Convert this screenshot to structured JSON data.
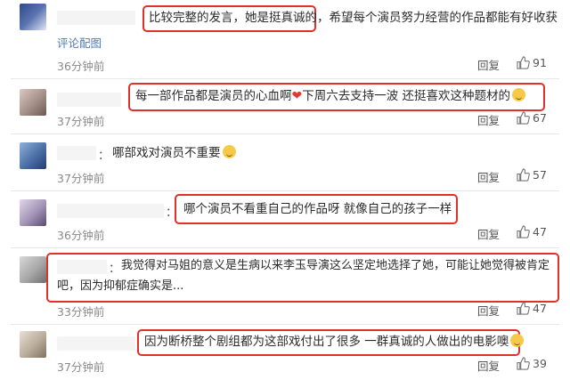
{
  "comments": [
    {
      "text": "比较完整的发言，她是挺真诚的，希望每个演员努力经营的作品都能有好收获",
      "sub_link": "评论配图",
      "time": "36分钟前",
      "reply": "回复",
      "likes": "91"
    },
    {
      "text_a": "每一部作品都是演员的心血啊",
      "heart": "❤",
      "text_b": "下周六去支持一波 还挺喜欢这种题材的",
      "time": "37分钟前",
      "reply": "回复",
      "likes": "67"
    },
    {
      "colon": "：",
      "text": "哪部戏对演员不重要",
      "time": "37分钟前",
      "reply": "回复",
      "likes": "57"
    },
    {
      "colon": "：",
      "text": "哪个演员不看重自己的作品呀 就像自己的孩子一样",
      "time": "36分钟前",
      "reply": "回复",
      "likes": "47"
    },
    {
      "colon": "：",
      "text_line1": "我觉得对马姐的意义是生病以来李玉导演这么坚定地选择了她，可能让她觉得被肯定",
      "text_line2": "吧，因为抑郁症确实是...",
      "time": "33分钟前",
      "reply": "回复",
      "likes": "47"
    },
    {
      "text": "因为断桥整个剧组都为这部戏付出了很多 一群真诚的人做出的电影噢",
      "time": "37分钟前",
      "reply": "回复",
      "likes": "39"
    }
  ],
  "colors": {
    "highlight": "#e0302a",
    "link": "#4f7bb8",
    "muted": "#8a8a8a"
  },
  "icons": {
    "like": "thumbs-up-icon"
  }
}
